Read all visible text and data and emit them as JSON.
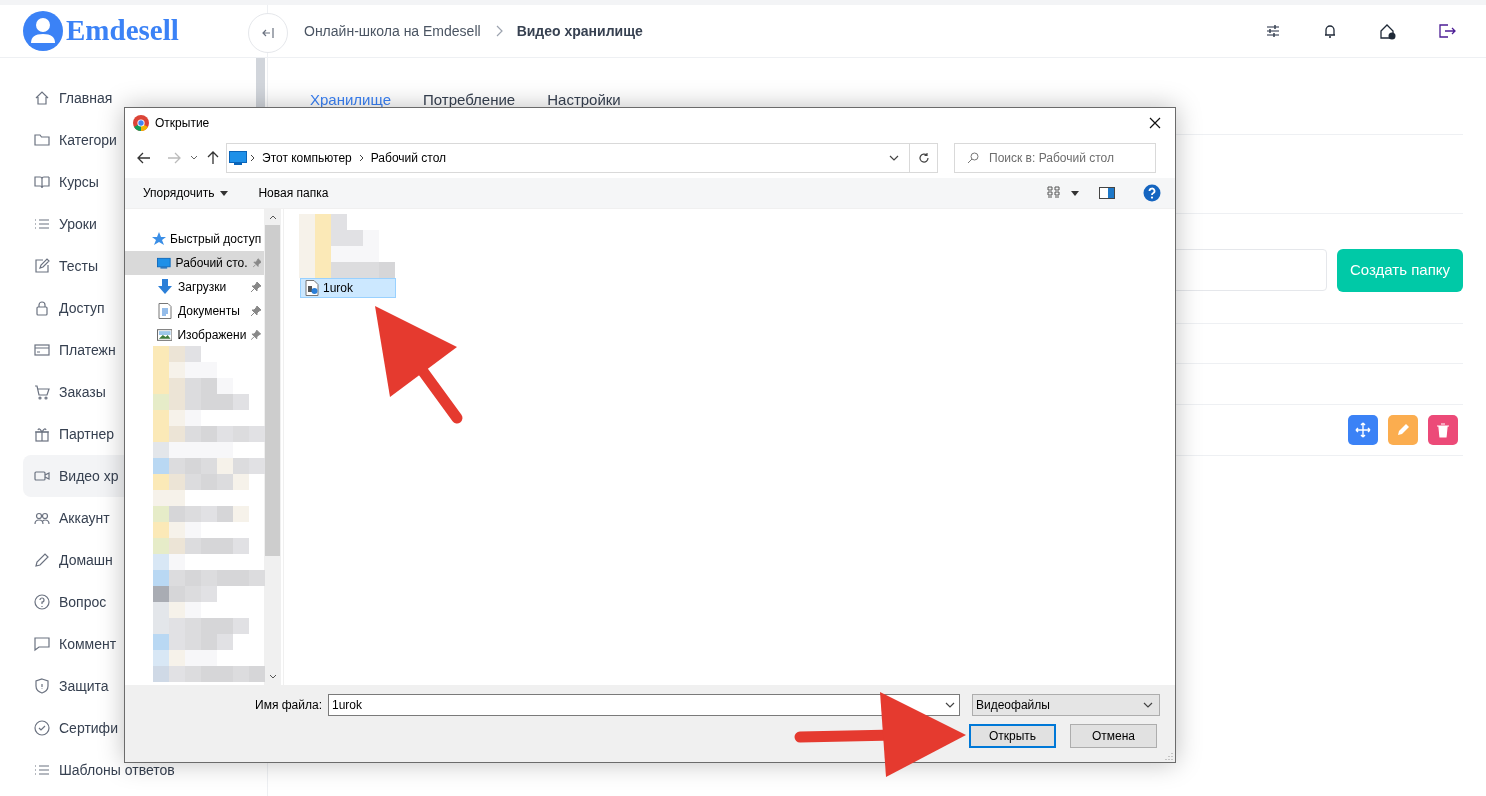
{
  "logo": {
    "text": "Emdesell"
  },
  "breadcrumb": [
    {
      "label": "Онлайн-школа на Emdesell",
      "current": false
    },
    {
      "label": "Видео хранилище",
      "current": true
    }
  ],
  "sidebar": {
    "items": [
      {
        "label": "Главная",
        "selected": false
      },
      {
        "label": "Категори",
        "selected": false
      },
      {
        "label": "Курсы",
        "selected": false
      },
      {
        "label": "Уроки",
        "selected": false
      },
      {
        "label": "Тесты",
        "selected": false
      },
      {
        "label": "Доступ",
        "selected": false
      },
      {
        "label": "Платежн",
        "selected": false
      },
      {
        "label": "Заказы",
        "selected": false
      },
      {
        "label": "Партнер",
        "selected": false
      },
      {
        "label": "Видео хр",
        "selected": true
      },
      {
        "label": "Аккаунт",
        "selected": false
      },
      {
        "label": "Домашн",
        "selected": false
      },
      {
        "label": "Вопрос",
        "selected": false
      },
      {
        "label": "Коммент",
        "selected": false
      },
      {
        "label": "Защита",
        "selected": false
      },
      {
        "label": "Сертифи",
        "selected": false
      },
      {
        "label": "Шаблоны ответов",
        "selected": false
      }
    ]
  },
  "tabs": [
    {
      "label": "Хранилище",
      "selected": true
    },
    {
      "label": "Потребление",
      "selected": false
    },
    {
      "label": "Настройки",
      "selected": false
    }
  ],
  "create_folder_button": "Создать папку",
  "dialog": {
    "title": "Открытие",
    "path": [
      "Этот компьютер",
      "Рабочий стол"
    ],
    "search_placeholder": "Поиск в: Рабочий стол",
    "toolbar": [
      {
        "label": "Упорядочить",
        "dropdown": true
      },
      {
        "label": "Новая папка",
        "dropdown": false
      }
    ],
    "nav_items": [
      {
        "kind": "group",
        "label": "Быстрый доступ",
        "selected": false,
        "pinned": false
      },
      {
        "kind": "place",
        "label": "Рабочий сто.",
        "selected": true,
        "pinned": true
      },
      {
        "kind": "place",
        "label": "Загрузки",
        "selected": false,
        "pinned": true
      },
      {
        "kind": "place",
        "label": "Документы",
        "selected": false,
        "pinned": true
      },
      {
        "kind": "place",
        "label": "Изображени",
        "selected": false,
        "pinned": true
      }
    ],
    "files": [
      {
        "name": "1urok",
        "selected": true
      }
    ],
    "filename_label": "Имя файла:",
    "filename": "1urok",
    "file_type": "Видеофайлы",
    "buttons": [
      {
        "label": "Открыть",
        "kind": "primary"
      },
      {
        "label": "Отмена",
        "kind": "secondary"
      }
    ]
  }
}
